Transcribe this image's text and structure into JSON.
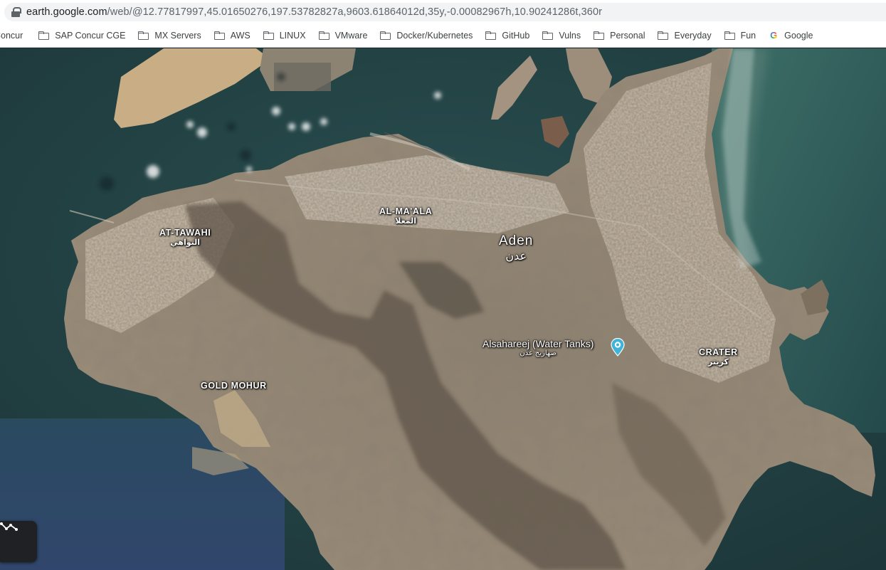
{
  "browser": {
    "url_host": "earth.google.com",
    "url_path": "/web/@12.77817997,45.01650276,197.53782827a,9603.61864012d,35y,-0.00082967h,10.90241286t,360r"
  },
  "bookmarks": [
    {
      "label": "Concur",
      "icon": "folder-icon"
    },
    {
      "label": "SAP Concur CGE",
      "icon": "folder-icon"
    },
    {
      "label": "MX Servers",
      "icon": "folder-icon"
    },
    {
      "label": "AWS",
      "icon": "folder-icon"
    },
    {
      "label": "LINUX",
      "icon": "folder-icon"
    },
    {
      "label": "VMware",
      "icon": "folder-icon"
    },
    {
      "label": "Docker/Kubernetes",
      "icon": "folder-icon"
    },
    {
      "label": "GitHub",
      "icon": "folder-icon"
    },
    {
      "label": "Vulns",
      "icon": "folder-icon"
    },
    {
      "label": "Personal",
      "icon": "folder-icon"
    },
    {
      "label": "Everyday",
      "icon": "folder-icon"
    },
    {
      "label": "Fun",
      "icon": "folder-icon"
    },
    {
      "label": "Google",
      "icon": "google-icon"
    }
  ],
  "map": {
    "colors": {
      "sea_dark": "#1d3b3f",
      "sea_teal": "#2f5c5b",
      "land": "#8a7e6e",
      "mountain": "#5e5448",
      "sand": "#b9a383",
      "pin": "#3fb4d6"
    },
    "labels": {
      "at_tawahi": "AT-TAWAHI",
      "at_tawahi_ar": "التواهي",
      "al_maala": "AL-MA'ALA",
      "al_maala_ar": "المعلا",
      "aden": "Aden",
      "aden_ar": "عدن",
      "gold_mohur": "GOLD MOHUR",
      "crater": "CRATER",
      "crater_ar": "كريتر",
      "poi": "Alsahareej (Water Tanks)",
      "poi_ar": "صهاريج عدن"
    },
    "poi_icon": "camera-pin-icon",
    "measure_icon": "measure-icon"
  }
}
